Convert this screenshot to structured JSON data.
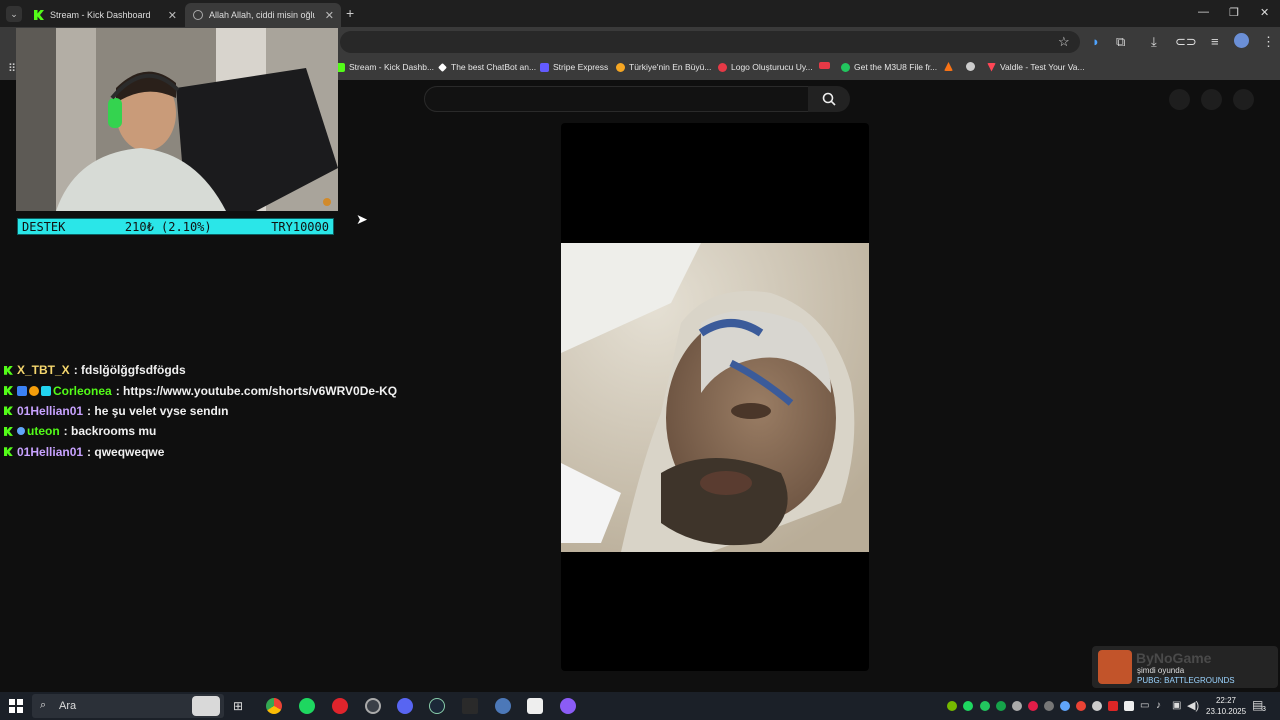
{
  "browser": {
    "tabs": [
      {
        "title": "Stream - Kick Dashboard"
      },
      {
        "title": "Allah Allah, ciddi misin oğlu..."
      }
    ],
    "bookmarks": [
      {
        "label": "Stream - Kick Dashb...",
        "color": "#53fc18"
      },
      {
        "label": "The best ChatBot an...",
        "color": "#ffffff"
      },
      {
        "label": "Stripe Express",
        "color": "#635bff"
      },
      {
        "label": "Türkiye'nin En Büyü...",
        "color": "#f5a623"
      },
      {
        "label": "Logo Oluşturucu Uy...",
        "color": "#e63946"
      },
      {
        "label": "",
        "color": "#e63946"
      },
      {
        "label": "Get the M3U8 File fr...",
        "color": "#22c55e"
      },
      {
        "label": "",
        "color": "#f97316"
      },
      {
        "label": "",
        "color": "#cccccc"
      },
      {
        "label": "Valdle - Test Your Va...",
        "color": "#ff4655"
      }
    ],
    "window_controls": {
      "minimize": "—",
      "restore": "❐",
      "close": "✕"
    }
  },
  "overlay": {
    "donation": {
      "label": "DESTEK",
      "progress_text": "210₺ (2.10%)",
      "goal": "TRY10000",
      "progress_fraction": 0.021
    }
  },
  "chat": {
    "messages": [
      {
        "user": "X_TBT_X",
        "text": "fdslğölğgfsdfögds",
        "color": "#f5d76e",
        "badges": []
      },
      {
        "user": "Corleonea",
        "text": "https://www.youtube.com/shorts/v6WRV0De-KQ",
        "color": "#53fc18",
        "badges": [
          "#3b82f6",
          "#f59e0b",
          "#22d3ee"
        ]
      },
      {
        "user": "01Hellian01",
        "text": "he şu velet vyse sendın",
        "color": "#c8a2ff",
        "badges": []
      },
      {
        "user": "uteon",
        "text": "backrooms mu",
        "color": "#53fc18",
        "badges": [
          "#60a5fa"
        ]
      },
      {
        "user": "01Hellian01",
        "text": "qweqweqwe",
        "color": "#c8a2ff",
        "badges": []
      }
    ]
  },
  "now_playing": {
    "brand": "ByNoGame",
    "line1": "şimdi oyunda",
    "game": "PUBG: BATTLEGROUNDS"
  },
  "taskbar": {
    "search_placeholder": "Ara",
    "time": "22:27",
    "date": "23.10.2025",
    "notification_count": "3"
  }
}
